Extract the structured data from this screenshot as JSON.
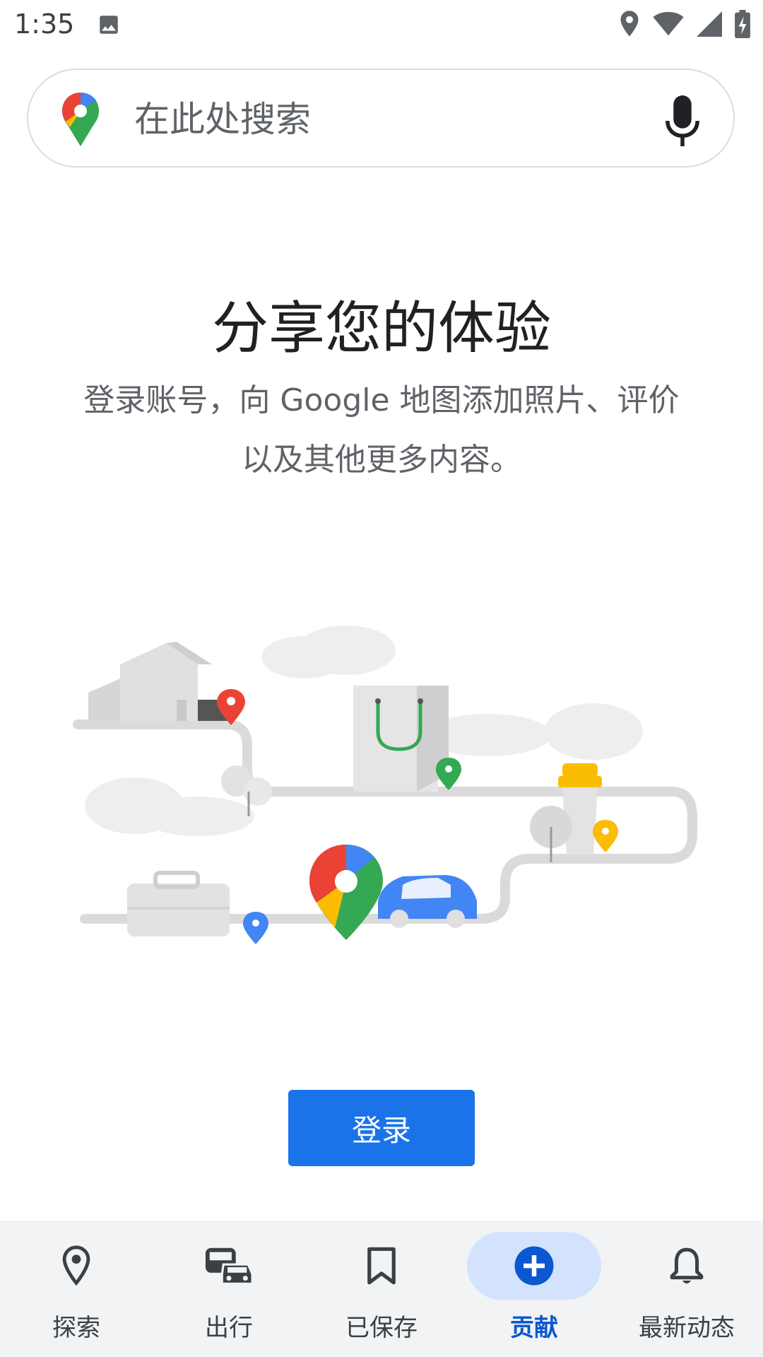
{
  "status_bar": {
    "time": "1:35",
    "icons": [
      "gallery-icon",
      "location-icon",
      "wifi-icon",
      "signal-icon",
      "battery-charging-icon"
    ]
  },
  "search": {
    "placeholder": "在此处搜索",
    "logo_icon": "google-maps-pin-icon",
    "mic_icon": "mic-icon"
  },
  "main": {
    "headline": "分享您的体验",
    "subtitle": "登录账号，向 Google 地图添加照片、评价以及其他更多内容。",
    "sign_in_label": "登录"
  },
  "bottom_nav": {
    "items": [
      {
        "label": "探索",
        "icon": "pin-outline-icon",
        "active": false
      },
      {
        "label": "出行",
        "icon": "commute-icon",
        "active": false
      },
      {
        "label": "已保存",
        "icon": "bookmark-icon",
        "active": false
      },
      {
        "label": "贡献",
        "icon": "add-circle-icon",
        "active": true
      },
      {
        "label": "最新动态",
        "icon": "bell-icon",
        "active": false
      }
    ]
  },
  "colors": {
    "primary": "#1a73e8",
    "active_tab_bg": "#d3e3fd",
    "active_tab_text": "#0b57d0",
    "maps_red": "#ea4335",
    "maps_yellow": "#fbbc04",
    "maps_green": "#34a853",
    "maps_blue": "#4285f4"
  }
}
